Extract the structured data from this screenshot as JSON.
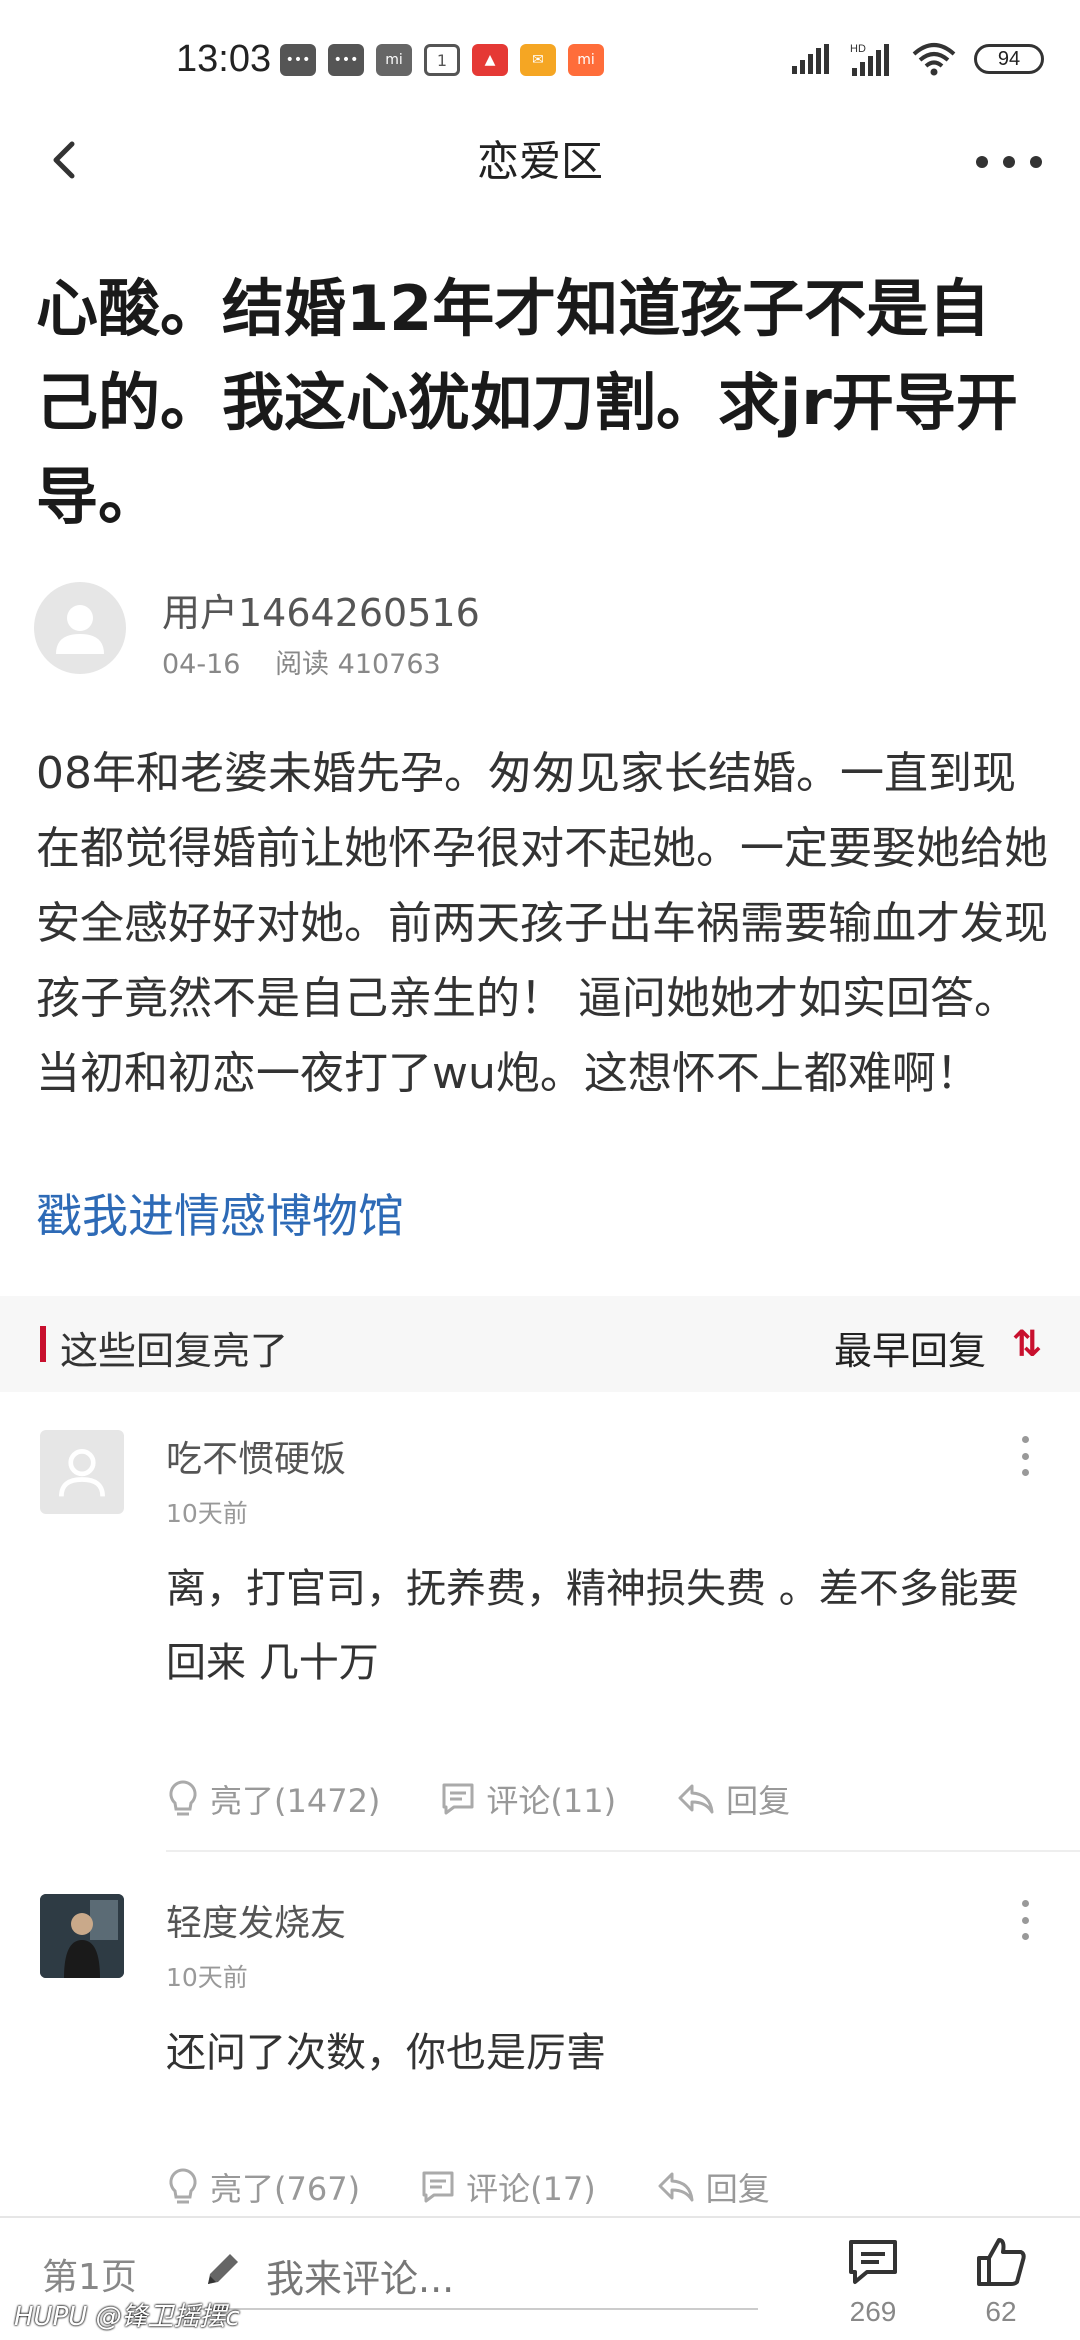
{
  "status_bar": {
    "time": "13:03",
    "battery": "94",
    "notif_calendar": "1"
  },
  "nav": {
    "title": "恋爱区"
  },
  "post": {
    "title": "心酸。结婚12年才知道孩子不是自己的。我这心犹如刀割。求jr开导开导。",
    "author": "用户1464260516",
    "date": "04-16",
    "reads": "阅读 410763",
    "body": "08年和老婆未婚先孕。匆匆见家长结婚。一直到现在都觉得婚前让她怀孕很对不起她。一定要娶她给她安全感好好对她。前两天孩子出车祸需要输血才发现孩子竟然不是自己亲生的！ 逼问她她才如实回答。当初和初恋一夜打了wu炮。这想怀不上都难啊！",
    "link": "戳我进情感博物馆"
  },
  "replies_header": {
    "title": "这些回复亮了",
    "sort": "最早回复",
    "sort_icon": "sort-arrows-icon"
  },
  "comments": [
    {
      "user": "吃不惯硬饭",
      "time": "10天前",
      "text": "离，打官司，抚养费，精神损失费 。差不多能要回来 几十万",
      "likes": "亮了(1472)",
      "replies": "评论(11)",
      "reply": "回复"
    },
    {
      "user": "轻度发烧友",
      "time": "10天前",
      "text": "还问了次数，你也是厉害",
      "likes": "亮了(767)",
      "replies": "评论(17)",
      "reply": "回复"
    }
  ],
  "bottom_bar": {
    "page": "第1页",
    "placeholder": "我来评论...",
    "comment_count": "269",
    "like_count": "62",
    "watermark": "HUPU @锋卫摇摆c"
  },
  "colors": {
    "accent_red": "#c8102e",
    "link_blue": "#2d6ab6"
  }
}
